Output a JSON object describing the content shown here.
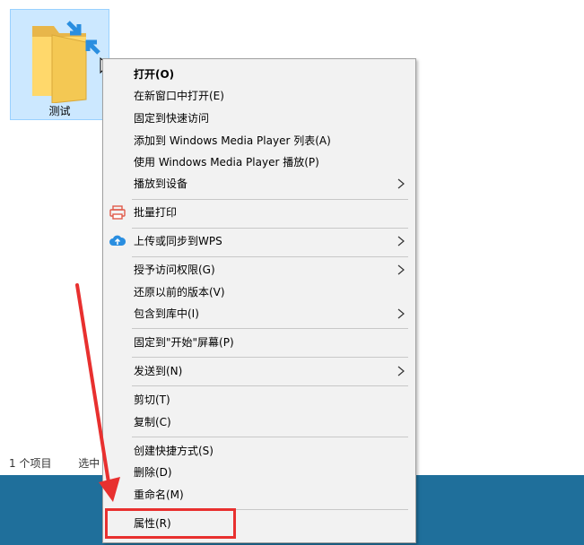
{
  "folder": {
    "name": "测试"
  },
  "status_bar": {
    "item_count": "1 个项目",
    "selected": "选中"
  },
  "context_menu": {
    "items": [
      {
        "label": "打开(O)"
      },
      {
        "label": "在新窗口中打开(E)"
      },
      {
        "label": "固定到快速访问"
      },
      {
        "label": "添加到 Windows Media Player 列表(A)"
      },
      {
        "label": "使用 Windows Media Player 播放(P)"
      },
      {
        "label": "播放到设备"
      },
      {
        "label": "批量打印"
      },
      {
        "label": "上传或同步到WPS"
      },
      {
        "label": "授予访问权限(G)"
      },
      {
        "label": "还原以前的版本(V)"
      },
      {
        "label": "包含到库中(I)"
      },
      {
        "label": "固定到\"开始\"屏幕(P)"
      },
      {
        "label": "发送到(N)"
      },
      {
        "label": "剪切(T)"
      },
      {
        "label": "复制(C)"
      },
      {
        "label": "创建快捷方式(S)"
      },
      {
        "label": "删除(D)"
      },
      {
        "label": "重命名(M)"
      },
      {
        "label": "属性(R)"
      }
    ]
  },
  "colors": {
    "selection_bg": "#cce8ff",
    "menu_bg": "#f2f2f2",
    "annotation_red": "#e8302f",
    "taskbar": "#1f6f9b"
  }
}
